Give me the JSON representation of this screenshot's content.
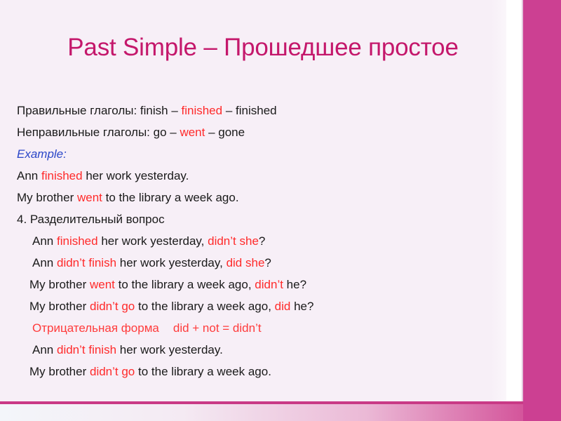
{
  "slide": {
    "title": "Past Simple – Прошедшее простое",
    "colors": {
      "background": "#F7EFF7",
      "title": "#C4176B",
      "accent_band": "#CC4092",
      "highlight_red": "#FF2A2A",
      "example_blue": "#2B47C8",
      "body_text": "#1A1A1A"
    },
    "lines": [
      {
        "id": "regular-verbs",
        "indent": 0,
        "segments": [
          {
            "text": "Правильные глаголы: finish – ",
            "style": "normal"
          },
          {
            "text": "finished",
            "style": "red"
          },
          {
            "text": " – finished",
            "style": "normal"
          }
        ]
      },
      {
        "id": "irregular-verbs",
        "indent": 0,
        "segments": [
          {
            "text": "Неправильные глаголы: go – ",
            "style": "normal"
          },
          {
            "text": "went",
            "style": "red"
          },
          {
            "text": " – gone",
            "style": "normal"
          }
        ]
      },
      {
        "id": "example-label",
        "indent": 0,
        "segments": [
          {
            "text": "Example:",
            "style": "blue-italic"
          }
        ]
      },
      {
        "id": "example-ann",
        "indent": 0,
        "segments": [
          {
            "text": "Ann ",
            "style": "normal"
          },
          {
            "text": "finished",
            "style": "red"
          },
          {
            "text": " her work yesterday.",
            "style": "normal"
          }
        ]
      },
      {
        "id": "example-brother",
        "indent": 0,
        "segments": [
          {
            "text": "My brother ",
            "style": "normal"
          },
          {
            "text": "went",
            "style": "red"
          },
          {
            "text": " to the library a week ago.",
            "style": "normal"
          }
        ]
      },
      {
        "id": "section-tag-question",
        "indent": 0,
        "segments": [
          {
            "text": "4. Разделительный вопрос",
            "style": "normal"
          }
        ]
      },
      {
        "id": "tag-ann-positive",
        "indent": 1,
        "segments": [
          {
            "text": "Ann ",
            "style": "normal"
          },
          {
            "text": "finished",
            "style": "red"
          },
          {
            "text": " her work yesterday, ",
            "style": "normal"
          },
          {
            "text": "didn’t she",
            "style": "red"
          },
          {
            "text": "?",
            "style": "normal"
          }
        ]
      },
      {
        "id": "tag-ann-negative",
        "indent": 1,
        "segments": [
          {
            "text": "Ann ",
            "style": "normal"
          },
          {
            "text": "didn’t finish",
            "style": "red"
          },
          {
            "text": " her work yesterday, ",
            "style": "normal"
          },
          {
            "text": "did she",
            "style": "red"
          },
          {
            "text": "?",
            "style": "normal"
          }
        ]
      },
      {
        "id": "tag-brother-positive",
        "indent": 2,
        "segments": [
          {
            "text": "My brother ",
            "style": "normal"
          },
          {
            "text": "went",
            "style": "red"
          },
          {
            "text": " to the library a week ago, ",
            "style": "normal"
          },
          {
            "text": "didn’t",
            "style": "red"
          },
          {
            "text": " he?",
            "style": "normal"
          }
        ]
      },
      {
        "id": "tag-brother-negative",
        "indent": 2,
        "segments": [
          {
            "text": "My brother ",
            "style": "normal"
          },
          {
            "text": "didn’t go",
            "style": "red"
          },
          {
            "text": " to the library a week ago, ",
            "style": "normal"
          },
          {
            "text": "did",
            "style": "red"
          },
          {
            "text": " he?",
            "style": "normal"
          }
        ]
      },
      {
        "id": "negative-form-heading",
        "indent": 1,
        "segments": [
          {
            "text": "Отрицательная форма",
            "style": "all-red"
          },
          {
            "text": "",
            "style": "gap"
          },
          {
            "text": "did + not = didn’t",
            "style": "all-red"
          }
        ]
      },
      {
        "id": "negative-ann",
        "indent": 1,
        "segments": [
          {
            "text": "Ann ",
            "style": "normal"
          },
          {
            "text": "didn’t finish",
            "style": "red"
          },
          {
            "text": " her work yesterday.",
            "style": "normal"
          }
        ]
      },
      {
        "id": "negative-brother",
        "indent": 2,
        "segments": [
          {
            "text": "My brother ",
            "style": "normal"
          },
          {
            "text": "didn’t go",
            "style": "red"
          },
          {
            "text": " to the library a week ago.",
            "style": "normal"
          }
        ]
      }
    ]
  }
}
